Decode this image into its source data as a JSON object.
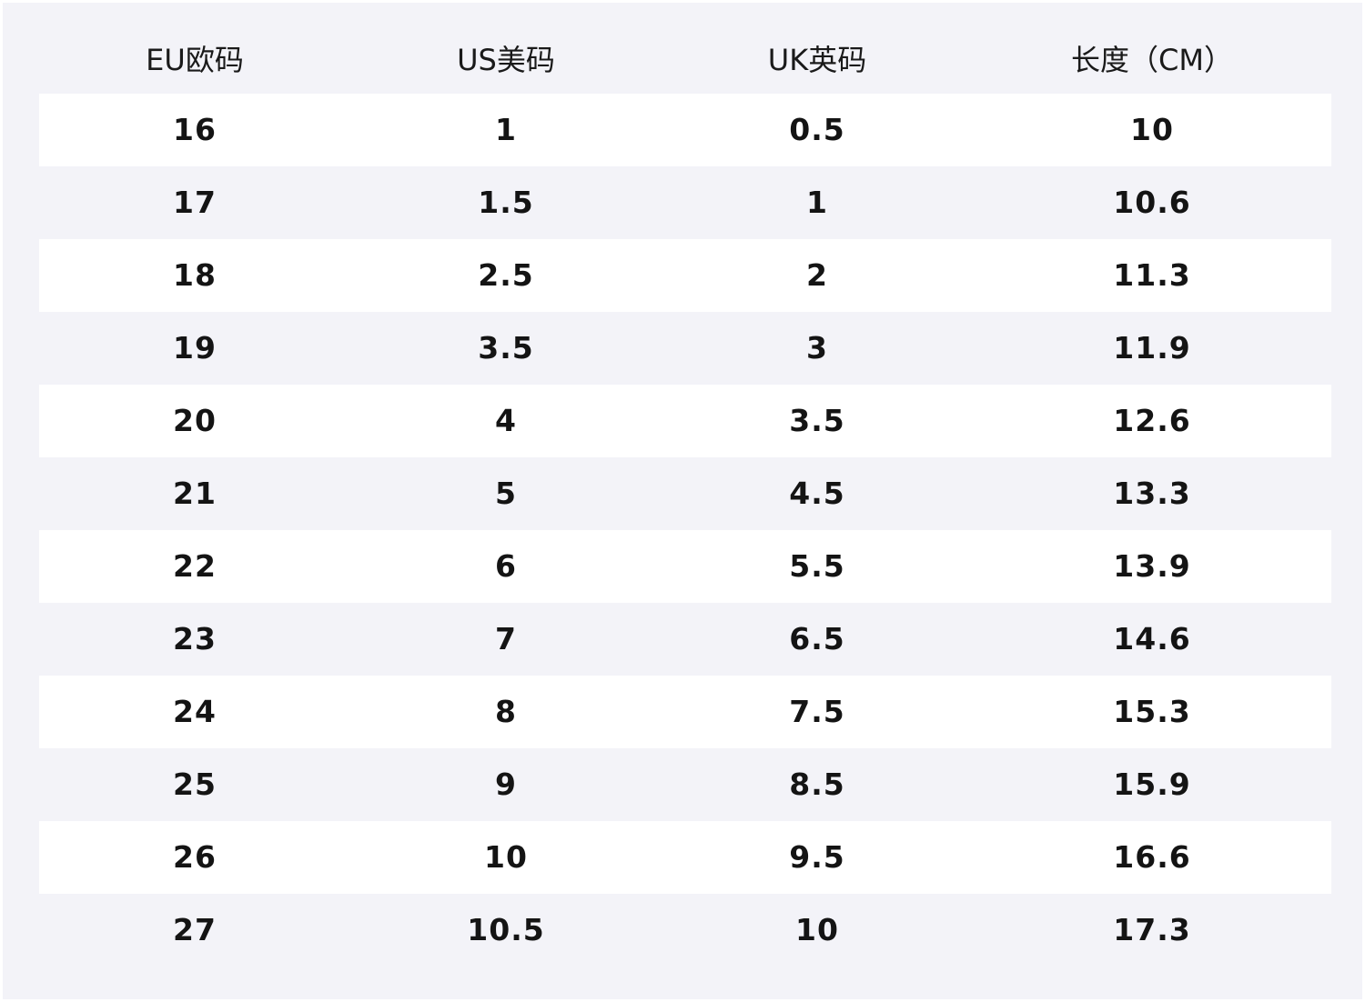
{
  "table": {
    "headers": [
      "EU欧码",
      "US美码",
      "UK英码",
      "长度（CM）"
    ],
    "rows": [
      [
        "16",
        "1",
        "0.5",
        "10"
      ],
      [
        "17",
        "1.5",
        "1",
        "10.6"
      ],
      [
        "18",
        "2.5",
        "2",
        "11.3"
      ],
      [
        "19",
        "3.5",
        "3",
        "11.9"
      ],
      [
        "20",
        "4",
        "3.5",
        "12.6"
      ],
      [
        "21",
        "5",
        "4.5",
        "13.3"
      ],
      [
        "22",
        "6",
        "5.5",
        "13.9"
      ],
      [
        "23",
        "7",
        "6.5",
        "14.6"
      ],
      [
        "24",
        "8",
        "7.5",
        "15.3"
      ],
      [
        "25",
        "9",
        "8.5",
        "15.9"
      ],
      [
        "26",
        "10",
        "9.5",
        "16.6"
      ],
      [
        "27",
        "10.5",
        "10",
        "17.3"
      ]
    ]
  },
  "colors": {
    "background": "#f3f3f8",
    "stripe": "#ffffff",
    "text": "#141414"
  }
}
